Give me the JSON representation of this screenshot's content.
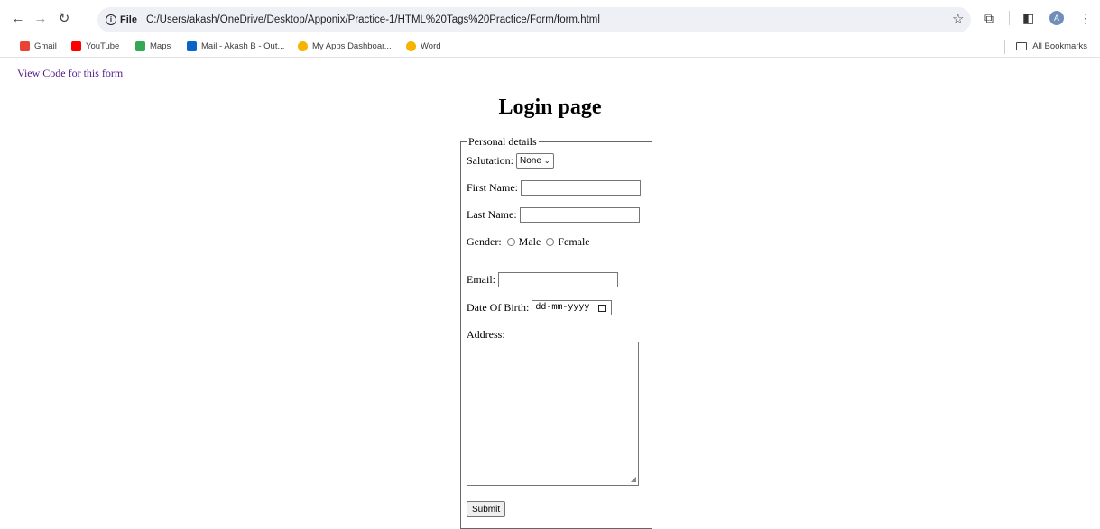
{
  "browser": {
    "url_scheme": "File",
    "url": "C:/Users/akash/OneDrive/Desktop/Apponix/Practice-1/HTML%20Tags%20Practice/Form/form.html",
    "avatar_letter": "A"
  },
  "bookmarks": {
    "items": [
      {
        "label": "Gmail",
        "icon": "gmail-icon",
        "color": "#ea4335"
      },
      {
        "label": "YouTube",
        "icon": "youtube-icon",
        "color": "#ff0000"
      },
      {
        "label": "Maps",
        "icon": "maps-icon",
        "color": "#34a853"
      },
      {
        "label": "Mail - Akash B - Out...",
        "icon": "outlook-icon",
        "color": "#0a64c8"
      },
      {
        "label": "My Apps Dashboar...",
        "icon": "apps-icon",
        "color": "#f4b400"
      },
      {
        "label": "Word",
        "icon": "word-icon",
        "color": "#f4b400"
      }
    ],
    "all_bookmarks": "All Bookmarks"
  },
  "page": {
    "view_code_link": "View Code for this form",
    "title": "Login page",
    "legend": "Personal details",
    "salutation_label": "Salutation:",
    "salutation_value": "None",
    "first_name_label": "First Name:",
    "last_name_label": "Last Name:",
    "gender_label": "Gender:",
    "gender_options": [
      "Male",
      "Female"
    ],
    "email_label": "Email:",
    "dob_label": "Date Of Birth:",
    "dob_placeholder": "dd-mm-yyyy",
    "address_label": "Address:",
    "submit_label": "Submit"
  }
}
